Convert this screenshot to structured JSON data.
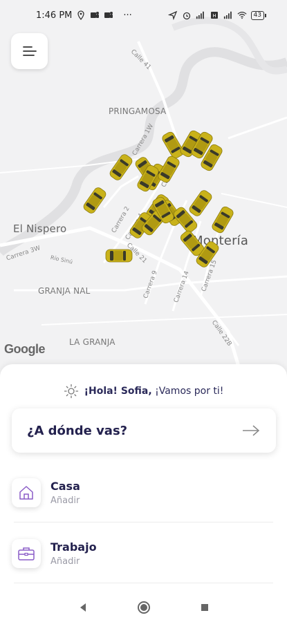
{
  "status_bar": {
    "time": "1:46 PM",
    "more": "···",
    "battery": "43",
    "icons": [
      "location-icon",
      "teams-icon",
      "teams-icon",
      "navigation-icon",
      "alarm-icon",
      "signal-icon",
      "signal-icon",
      "wifi-icon",
      "battery-icon"
    ]
  },
  "map": {
    "labels": {
      "pringamosa": "PRINGAMOSA",
      "el_nispero": "El Nispero",
      "monteria": "Montería",
      "granja_nal": "GRANJA NAL",
      "la_granja": "LA GRANJA"
    },
    "streets": {
      "calle41": "Calle 41",
      "carrera1w": "Carrera 1W",
      "carrera5": "Carrera 5",
      "carrera2": "Carrera 2",
      "carrera4": "Carrera 4",
      "calle21": "Calle 21",
      "carrera3w": "Carrera 3W",
      "rio_sinu": "Río Sinú",
      "carrera9": "Carrera 9",
      "carrera14": "Carrera 14",
      "carrera15": "Carrera 15",
      "calle22b": "Calle 22B"
    },
    "attribution": "Google",
    "vehicle_icon": "taxi-car-icon",
    "taxi_color": "#c9b21a"
  },
  "menu_button": {
    "icon": "menu-icon"
  },
  "sheet": {
    "greeting_icon": "sun-icon",
    "greeting_name": "¡Hola! Sofia,",
    "greeting_rest": "¡Vamos por ti!",
    "destination_prompt": "¿A dónde vas?",
    "destination_icon": "arrow-right-icon",
    "places": [
      {
        "title": "Casa",
        "subtitle": "Añadir",
        "icon": "home-icon"
      },
      {
        "title": "Trabajo",
        "subtitle": "Añadir",
        "icon": "briefcase-icon"
      }
    ]
  },
  "nav_bar": {
    "back_icon": "back-icon",
    "home_icon": "home-circle-icon",
    "recents_icon": "recents-icon"
  },
  "colors": {
    "brand_dark": "#23214e",
    "accent_purple": "#8a5cc7",
    "taxi_yellow": "#c9b21a"
  }
}
